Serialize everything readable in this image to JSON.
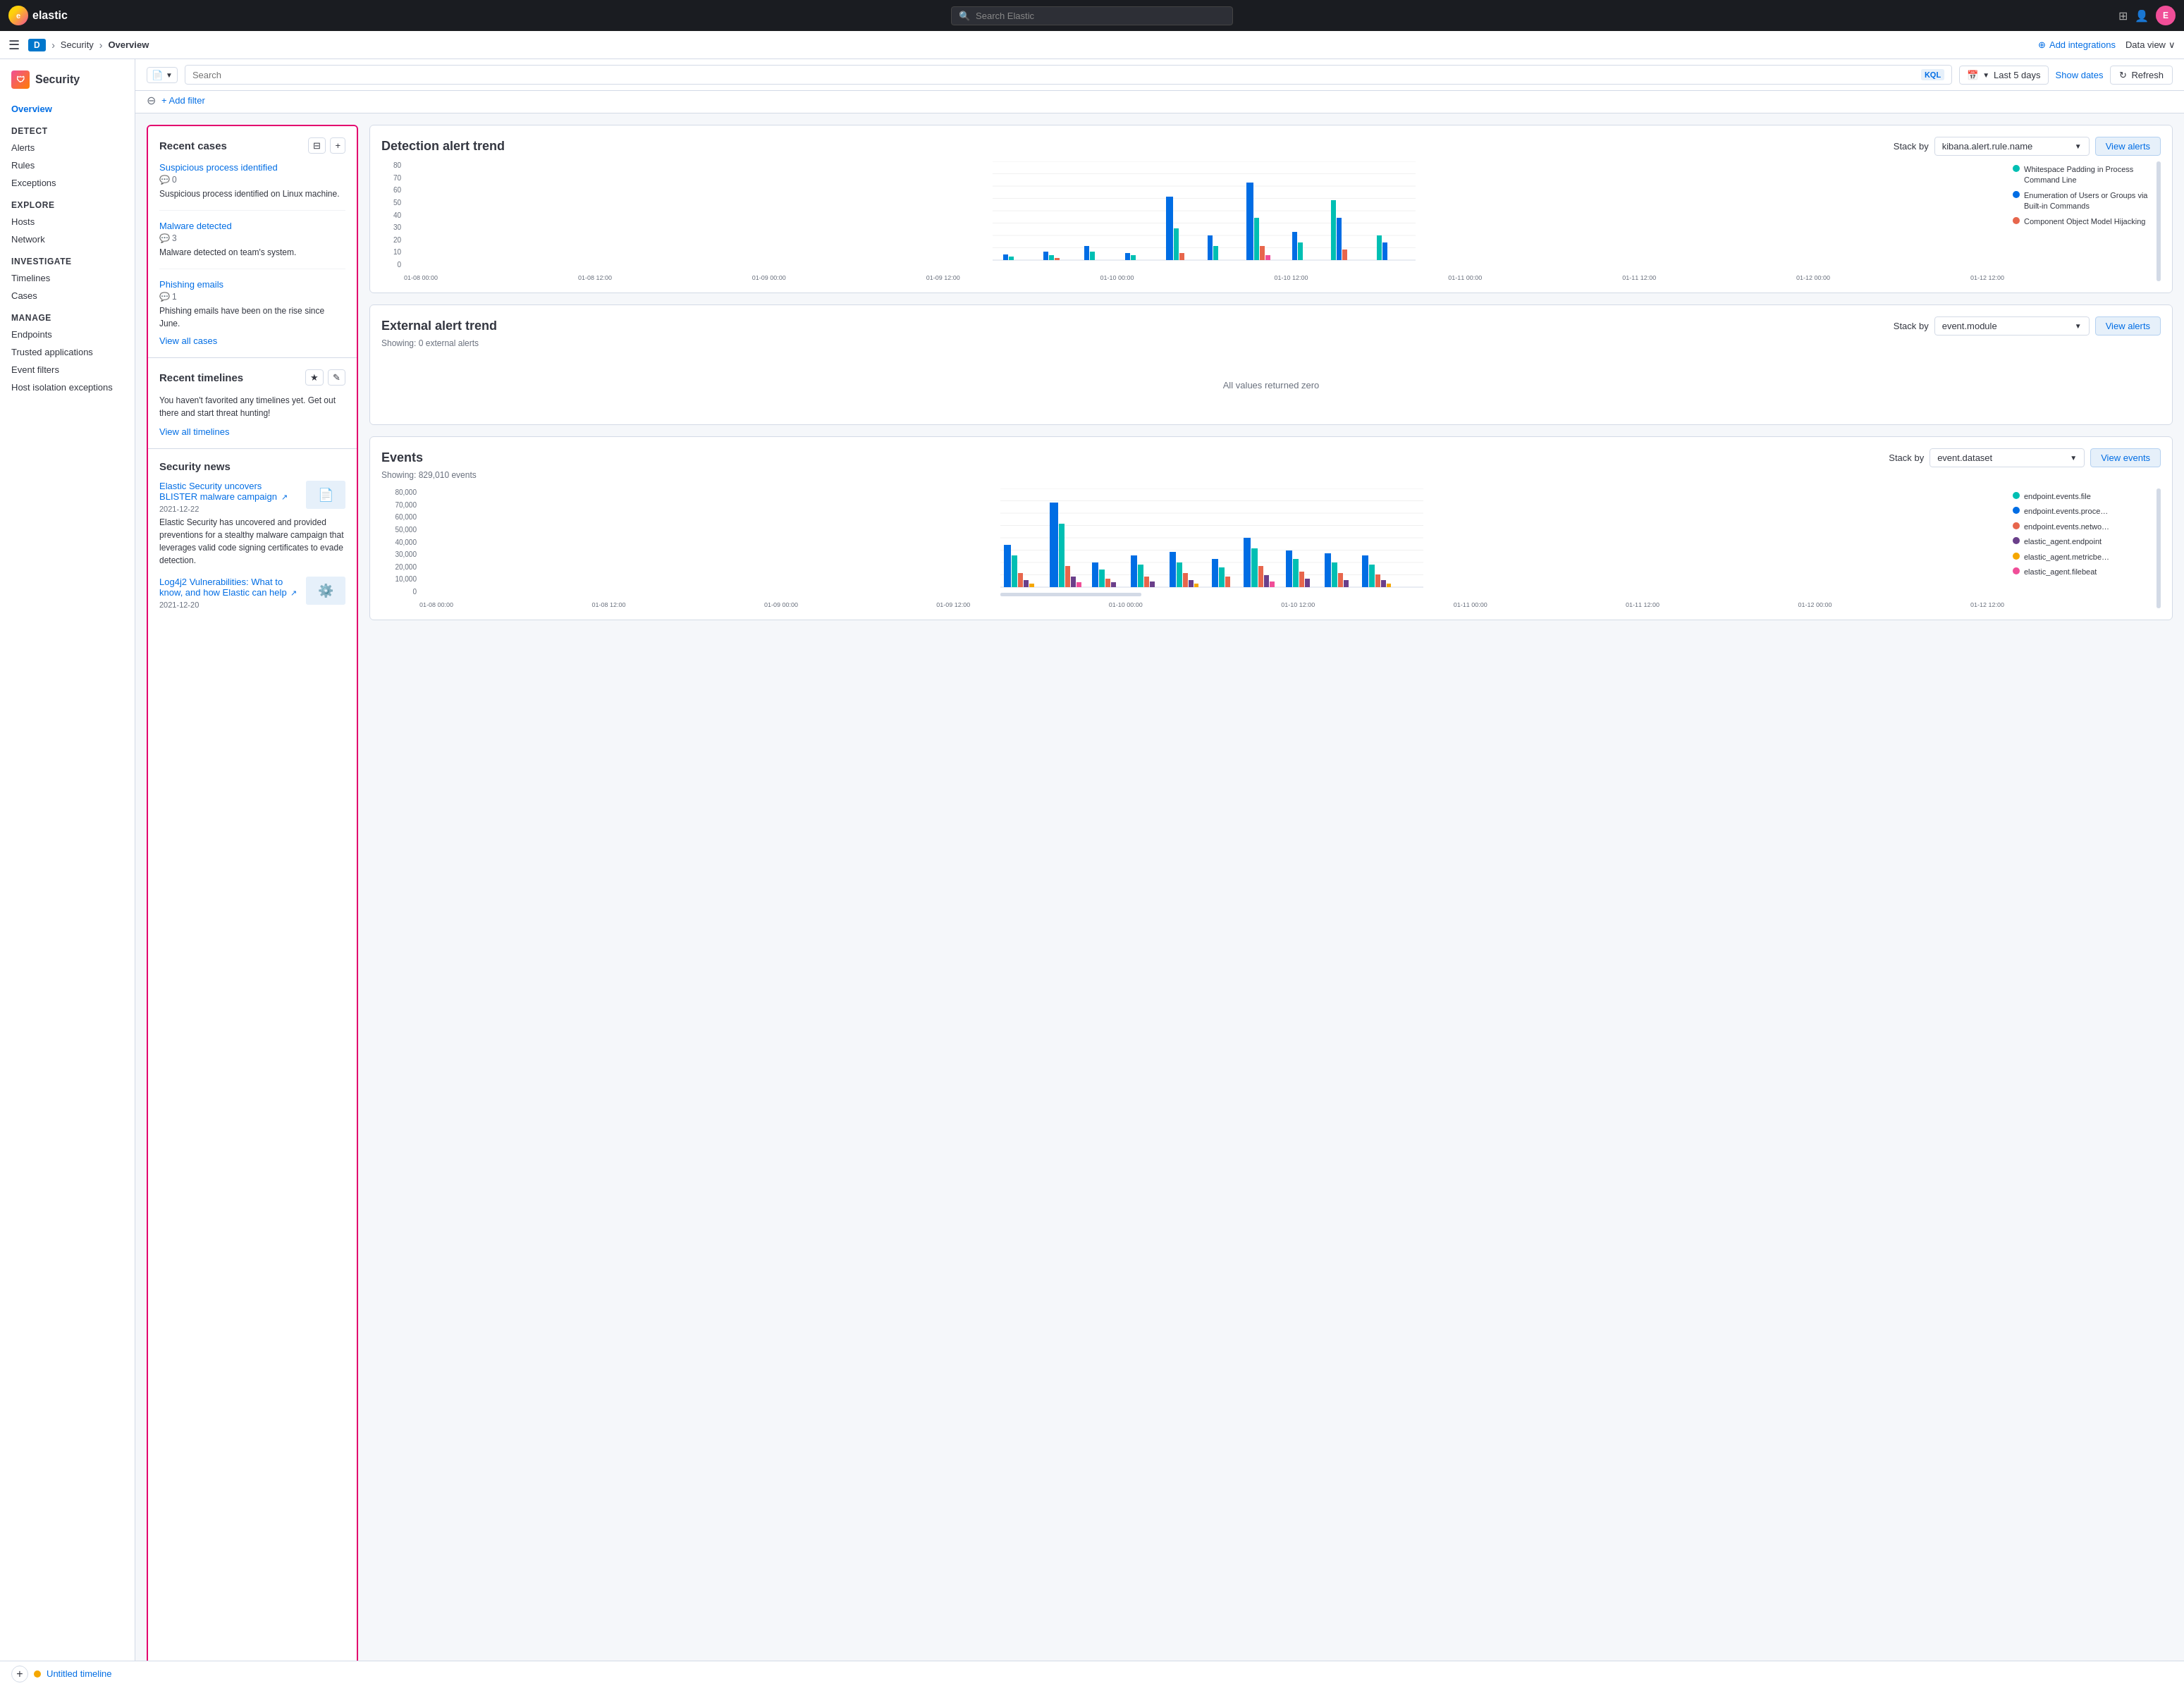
{
  "topnav": {
    "logo_text": "elastic",
    "search_placeholder": "Search Elastic",
    "avatar_letter": "E"
  },
  "breadcrumb": {
    "nav_label": "D",
    "section": "Security",
    "page": "Overview",
    "add_integrations": "Add integrations",
    "data_view": "Data view"
  },
  "filterbar": {
    "search_placeholder": "Search",
    "kql_label": "KQL",
    "date_range": "Last 5 days",
    "show_dates": "Show dates",
    "refresh": "Refresh",
    "add_filter": "+ Add filter"
  },
  "sidebar": {
    "title": "Security",
    "overview_link": "Overview",
    "sections": [
      {
        "title": "Detect",
        "items": [
          "Alerts",
          "Rules",
          "Exceptions"
        ]
      },
      {
        "title": "Explore",
        "items": [
          "Hosts",
          "Network"
        ]
      },
      {
        "title": "Investigate",
        "items": [
          "Timelines",
          "Cases"
        ]
      },
      {
        "title": "Manage",
        "items": [
          "Endpoints",
          "Trusted applications",
          "Event filters",
          "Host isolation exceptions"
        ]
      }
    ]
  },
  "recent_cases": {
    "title": "Recent cases",
    "cases": [
      {
        "title": "Suspicious process identified",
        "comments": "0",
        "description": "Suspicious process identified on Linux machine."
      },
      {
        "title": "Malware detected",
        "comments": "3",
        "description": "Malware detected on team's system."
      },
      {
        "title": "Phishing emails",
        "comments": "1",
        "description": "Phishing emails have been on the rise since June."
      }
    ],
    "view_all": "View all cases"
  },
  "recent_timelines": {
    "title": "Recent timelines",
    "empty_message": "You haven't favorited any timelines yet. Get out there and start threat hunting!",
    "view_all": "View all timelines"
  },
  "security_news": {
    "title": "Security news",
    "articles": [
      {
        "title": "Elastic Security uncovers BLISTER malware campaign",
        "date": "2021-12-22",
        "description": "Elastic Security has uncovered and provided preventions for a stealthy malware campaign that leverages valid code signing certificates to evade detection.",
        "thumb_icon": "📄"
      },
      {
        "title": "Log4j2 Vulnerabilities: What to know, and how Elastic can help",
        "date": "2021-12-20",
        "thumb_icon": "⚙️"
      }
    ]
  },
  "detection_alert": {
    "title": "Detection alert trend",
    "stack_by_label": "Stack by",
    "stack_by_value": "kibana.alert.rule.name",
    "view_btn": "View alerts",
    "legend": [
      {
        "label": "Whitespace Padding in Process Command Line",
        "color": "#00bfb3"
      },
      {
        "label": "Enumeration of Users or Groups via Built-in Commands",
        "color": "#006de4"
      },
      {
        "label": "Component Object Model Hijacking",
        "color": "#e7664c"
      }
    ],
    "y_labels": [
      "80",
      "70",
      "60",
      "50",
      "40",
      "30",
      "20",
      "10",
      "0"
    ],
    "x_labels": [
      "01-08 00:00",
      "01-08 12:00",
      "01-09 00:00",
      "01-09 12:00",
      "01-10 00:00",
      "01-10 12:00",
      "01-11 00:00",
      "01-11 12:00",
      "01-12 00:00",
      "01-12 12:00"
    ]
  },
  "external_alert": {
    "title": "External alert trend",
    "stack_by_label": "Stack by",
    "stack_by_value": "event.module",
    "view_btn": "View alerts",
    "subtitle": "Showing: 0 external alerts",
    "empty_message": "All values returned zero"
  },
  "events": {
    "title": "Events",
    "subtitle": "Showing: 829,010 events",
    "stack_by_label": "Stack by",
    "stack_by_value": "event.dataset",
    "view_btn": "View events",
    "legend": [
      {
        "label": "endpoint.events.file",
        "color": "#00bfb3"
      },
      {
        "label": "endpoint.events.proce…",
        "color": "#006de4"
      },
      {
        "label": "endpoint.events.netwo…",
        "color": "#e7664c"
      },
      {
        "label": "elastic_agent.endpoint",
        "color": "#6a3f8a"
      },
      {
        "label": "elastic_agent.metricbe…",
        "color": "#f5a700"
      },
      {
        "label": "elastic_agent.filebeat",
        "color": "#f04e98"
      }
    ],
    "y_labels": [
      "80,000",
      "70,000",
      "60,000",
      "50,000",
      "40,000",
      "30,000",
      "20,000",
      "10,000",
      "0"
    ],
    "x_labels": [
      "01-08 00:00",
      "01-08 12:00",
      "01-09 00:00",
      "01-09 12:00",
      "01-10 00:00",
      "01-10 12:00",
      "01-11 00:00",
      "01-11 12:00",
      "01-12 00:00",
      "01-12 12:00"
    ]
  },
  "timeline_bar": {
    "title": "Untitled timeline"
  }
}
